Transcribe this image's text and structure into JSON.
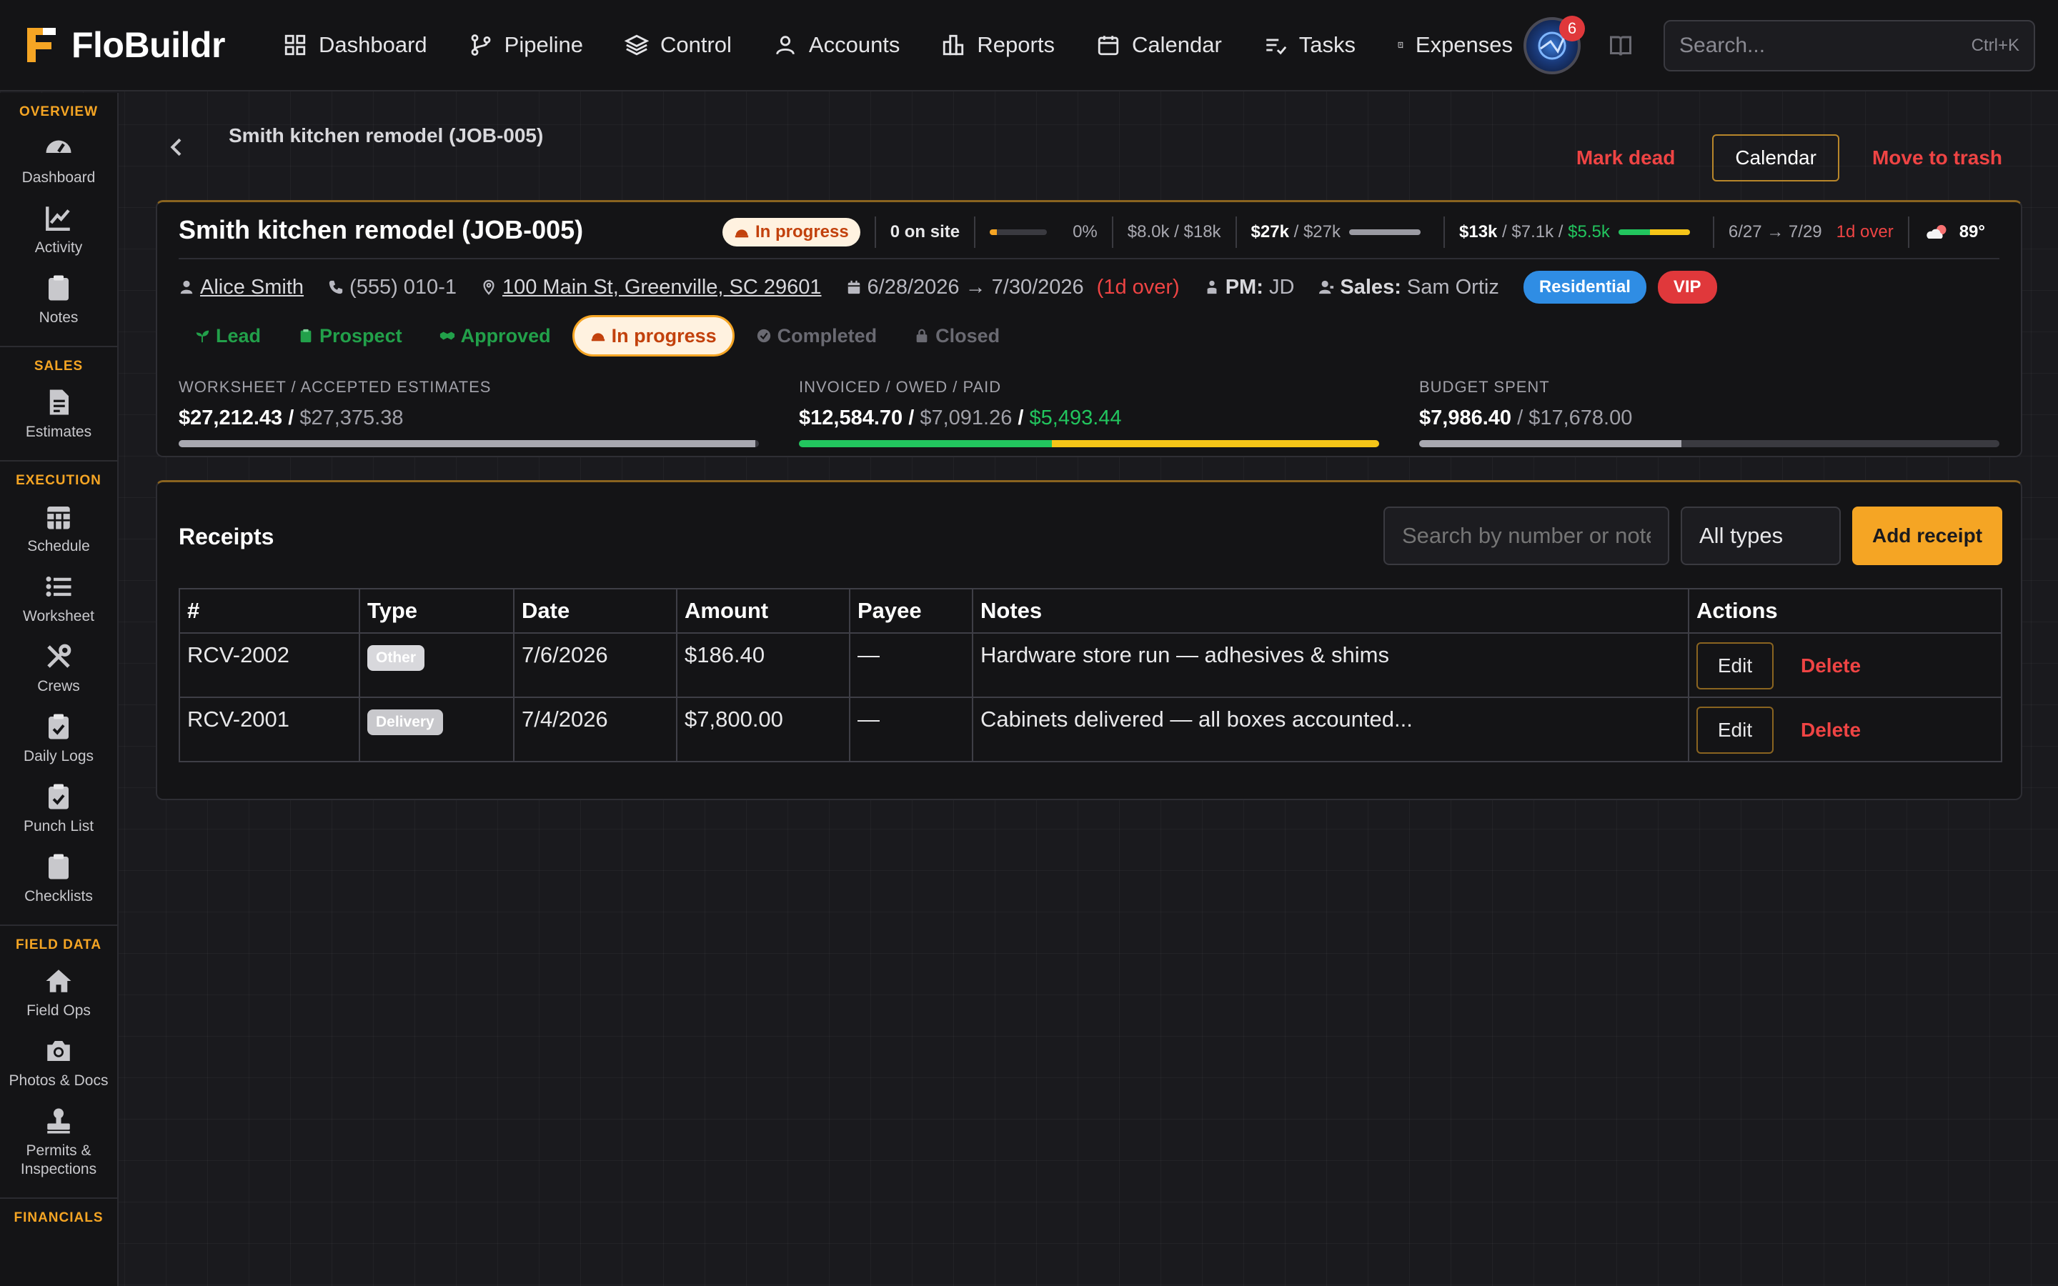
{
  "app": {
    "name": "FloBuildr"
  },
  "nav": [
    {
      "label": "Dashboard",
      "icon": "grid-icon"
    },
    {
      "label": "Pipeline",
      "icon": "branch-icon"
    },
    {
      "label": "Control",
      "icon": "layers-icon"
    },
    {
      "label": "Accounts",
      "icon": "user-icon"
    },
    {
      "label": "Reports",
      "icon": "building-icon"
    },
    {
      "label": "Calendar",
      "icon": "calendar-icon"
    },
    {
      "label": "Tasks",
      "icon": "tasks-icon"
    },
    {
      "label": "Expenses",
      "icon": "receipt-icon"
    }
  ],
  "notifications": {
    "count": "6"
  },
  "search": {
    "placeholder": "Search...",
    "shortcut": "Ctrl+K"
  },
  "sidebar": [
    {
      "heading": "OVERVIEW",
      "items": [
        {
          "label": "Dashboard",
          "icon": "gauge-icon"
        },
        {
          "label": "Activity",
          "icon": "chart-line-icon"
        },
        {
          "label": "Notes",
          "icon": "clipboard-icon"
        }
      ]
    },
    {
      "heading": "SALES",
      "items": [
        {
          "label": "Estimates",
          "icon": "file-invoice-icon"
        }
      ]
    },
    {
      "heading": "EXECUTION",
      "items": [
        {
          "label": "Schedule",
          "icon": "calendar-grid-icon"
        },
        {
          "label": "Worksheet",
          "icon": "list-icon"
        },
        {
          "label": "Crews",
          "icon": "tools-icon"
        },
        {
          "label": "Daily Logs",
          "icon": "clipboard-check-icon"
        },
        {
          "label": "Punch List",
          "icon": "clipboard-check-icon"
        },
        {
          "label": "Checklists",
          "icon": "clipboard-icon"
        }
      ]
    },
    {
      "heading": "FIELD DATA",
      "items": [
        {
          "label": "Field Ops",
          "icon": "home-icon"
        },
        {
          "label": "Photos & Docs",
          "icon": "camera-icon"
        },
        {
          "label": "Permits & Inspections",
          "icon": "stamp-icon"
        }
      ]
    },
    {
      "heading": "FINANCIALS",
      "items": []
    }
  ],
  "header": {
    "breadcrumb": "Smith kitchen remodel (JOB-005)",
    "mark_dead": "Mark dead",
    "calendar": "Calendar",
    "move_to_trash": "Move to trash"
  },
  "job": {
    "title": "Smith kitchen remodel (JOB-005)",
    "status": "In progress",
    "on_site": "0 on site",
    "progress_pct": "0%",
    "progress_fill": 0.12,
    "budget_short": {
      "spent": "$8.0k",
      "total": "$18k"
    },
    "estimate_short": {
      "worksheet": "$27k",
      "accepted": "$27k",
      "fill": 1.0
    },
    "invoice_short": {
      "invoiced": "$13k",
      "owed": "$7.1k",
      "paid": "$5.5k",
      "paid_fill": 0.44
    },
    "dates_short": {
      "start": "6/27",
      "end": "7/29",
      "arrow": "→",
      "over": "1d over"
    },
    "weather": {
      "temp": "89°",
      "icon": "cloud-sun-icon"
    },
    "client": "Alice Smith",
    "phone": "(555) 010-1",
    "address": "100 Main St, Greenville, SC 29601",
    "dates": {
      "start": "6/28/2026",
      "end": "7/30/2026",
      "arrow": "→",
      "over": "(1d over)"
    },
    "pm": {
      "label": "PM:",
      "value": "JD"
    },
    "sales": {
      "label": "Sales:",
      "value": "Sam Ortiz"
    },
    "tags": [
      {
        "label": "Residential",
        "color": "#2f8de4"
      },
      {
        "label": "VIP",
        "color": "#e0383b"
      }
    ],
    "stages": [
      {
        "label": "Lead",
        "state": "done",
        "icon": "seedling-icon"
      },
      {
        "label": "Prospect",
        "state": "done",
        "icon": "clipboard-icon"
      },
      {
        "label": "Approved",
        "state": "done",
        "icon": "handshake-icon"
      },
      {
        "label": "In progress",
        "state": "current",
        "icon": "hardhat-icon"
      },
      {
        "label": "Completed",
        "state": "todo",
        "icon": "check-circle-icon"
      },
      {
        "label": "Closed",
        "state": "todo",
        "icon": "lock-icon"
      }
    ],
    "financials": {
      "worksheet": {
        "label": "WORKSHEET / ACCEPTED ESTIMATES",
        "a": "$27,212.43",
        "b": "$27,375.38",
        "fill": 0.994
      },
      "invoiced": {
        "label": "INVOICED / OWED / PAID",
        "a": "$12,584.70",
        "b": "$7,091.26",
        "c": "$5,493.44",
        "paid_fill": 0.436,
        "owed_fill": 0.564
      },
      "budget": {
        "label": "BUDGET SPENT",
        "a": "$7,986.40",
        "b": "$17,678.00",
        "fill": 0.452
      }
    }
  },
  "receipts": {
    "title": "Receipts",
    "search_placeholder": "Search by number or notes",
    "type_filter": "All types",
    "add_label": "Add receipt",
    "columns": [
      "#",
      "Type",
      "Date",
      "Amount",
      "Payee",
      "Notes",
      "Actions"
    ],
    "rows": [
      {
        "number": "RCV-2002",
        "type": "Other",
        "date": "7/6/2026",
        "amount": "$186.40",
        "payee": "—",
        "notes": "Hardware store run — adhesives & shims"
      },
      {
        "number": "RCV-2001",
        "type": "Delivery",
        "date": "7/4/2026",
        "amount": "$7,800.00",
        "payee": "—",
        "notes": "Cabinets delivered — all boxes accounted..."
      }
    ],
    "edit_label": "Edit",
    "delete_label": "Delete"
  },
  "colors": {
    "accent": "#f5a524",
    "danger": "#ef4444",
    "success": "#22c55e",
    "paid_bar": "#22c55e",
    "owed_bar": "#f5c518"
  }
}
